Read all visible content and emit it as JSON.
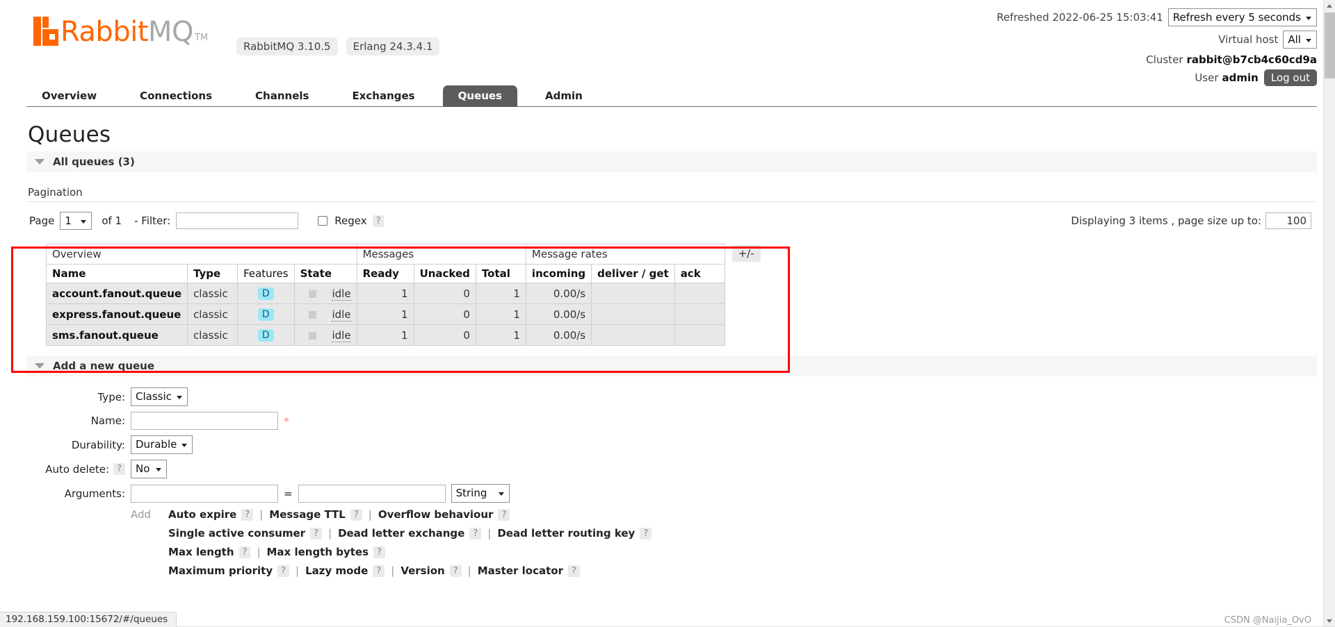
{
  "header": {
    "logo_rabbit": "Rabbit",
    "logo_mq": "MQ",
    "logo_tm": "TM",
    "version_rabbitmq": "RabbitMQ 3.10.5",
    "version_erlang": "Erlang 24.3.4.1",
    "refreshed_label": "Refreshed 2022-06-25 15:03:41",
    "refresh_select": "Refresh every 5 seconds",
    "vhost_label": "Virtual host",
    "vhost_select": "All",
    "cluster_label": "Cluster",
    "cluster_name": "rabbit@b7cb4c60cd9a",
    "user_label": "User",
    "user_name": "admin",
    "logout_button": "Log out"
  },
  "nav": {
    "tabs": [
      {
        "label": "Overview",
        "active": false
      },
      {
        "label": "Connections",
        "active": false
      },
      {
        "label": "Channels",
        "active": false
      },
      {
        "label": "Exchanges",
        "active": false
      },
      {
        "label": "Queues",
        "active": true
      },
      {
        "label": "Admin",
        "active": false
      }
    ]
  },
  "page": {
    "title": "Queues",
    "all_queues_header": "All queues (3)",
    "pagination_label": "Pagination",
    "page_label": "Page",
    "page_value": "1",
    "of_label": "of 1",
    "filter_label": "- Filter:",
    "filter_value": "",
    "regex_label": "Regex",
    "regex_help": "?",
    "displaying_text": "Displaying 3 items , page size up to:",
    "page_size_value": "100"
  },
  "table": {
    "group_headers": [
      "Overview",
      "Messages",
      "Message rates"
    ],
    "columns": [
      "Name",
      "Type",
      "Features",
      "State",
      "Ready",
      "Unacked",
      "Total",
      "incoming",
      "deliver / get",
      "ack"
    ],
    "plus_minus": "+/-",
    "rows": [
      {
        "name": "account.fanout.queue",
        "type": "classic",
        "features": "D",
        "state": "idle",
        "ready": "1",
        "unacked": "0",
        "total": "1",
        "incoming": "0.00/s",
        "deliver_get": "",
        "ack": ""
      },
      {
        "name": "express.fanout.queue",
        "type": "classic",
        "features": "D",
        "state": "idle",
        "ready": "1",
        "unacked": "0",
        "total": "1",
        "incoming": "0.00/s",
        "deliver_get": "",
        "ack": ""
      },
      {
        "name": "sms.fanout.queue",
        "type": "classic",
        "features": "D",
        "state": "idle",
        "ready": "1",
        "unacked": "0",
        "total": "1",
        "incoming": "0.00/s",
        "deliver_get": "",
        "ack": ""
      }
    ]
  },
  "add_queue": {
    "section_header": "Add a new queue",
    "type_label": "Type:",
    "type_value": "Classic",
    "name_label": "Name:",
    "name_value": "",
    "name_required": "*",
    "durability_label": "Durability:",
    "durability_value": "Durable",
    "auto_delete_label": "Auto delete:",
    "auto_delete_help": "?",
    "auto_delete_value": "No",
    "arguments_label": "Arguments:",
    "arg_key_value": "",
    "arg_equals": "=",
    "arg_val_value": "",
    "arg_type_value": "String",
    "add_label": "Add",
    "presets_row1": [
      "Auto expire",
      "Message TTL",
      "Overflow behaviour"
    ],
    "presets_row2": [
      "Single active consumer",
      "Dead letter exchange",
      "Dead letter routing key"
    ],
    "presets_row3": [
      "Max length",
      "Max length bytes"
    ],
    "presets_row4": [
      "Maximum priority",
      "Lazy mode",
      "Version",
      "Master locator"
    ],
    "help_glyph": "?",
    "separator": "|"
  },
  "statusbar": {
    "url": "192.168.159.100:15672/#/queues"
  },
  "watermark": "CSDN @Naijia_OvO",
  "colors": {
    "brand_orange": "#ff6600",
    "active_tab": "#5c5c5c",
    "highlight_red": "#ff0000",
    "feature_badge": "#9ae8f7",
    "row_bg": "#e8e8e8"
  }
}
